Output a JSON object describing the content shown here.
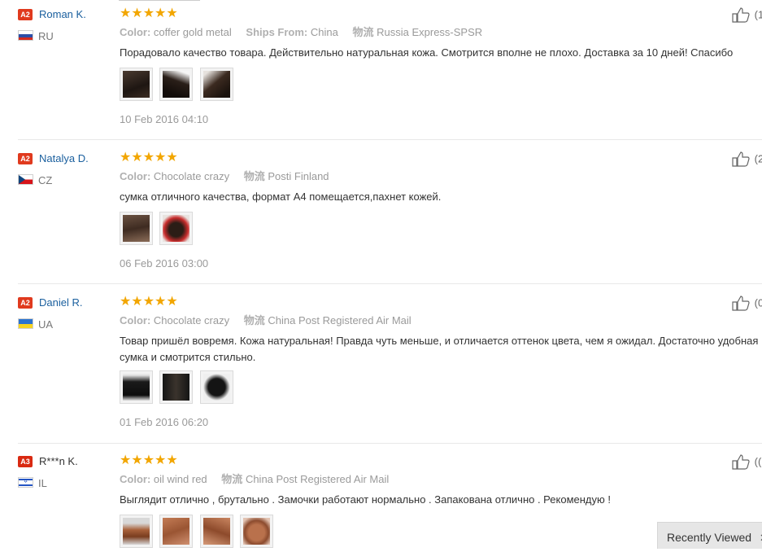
{
  "colors": {
    "star": "#f2a600",
    "link": "#1a5f9e",
    "badge_a2": "#e03a1e",
    "badge_a3": "#d92a12"
  },
  "reviews": [
    {
      "badge": "A2",
      "name": "Roman K.",
      "country": "RU",
      "flag": "ru",
      "stars": "★★★★★",
      "attr1_label": "Color:",
      "attr1_value": "coffer gold metal",
      "attr2_label": "Ships From:",
      "attr2_value": "China",
      "attr3_label": "物流",
      "attr3_value": "Russia Express-SPSR",
      "text": "Порадовало качество товара. Действительно натуральная кожа. Смотрится вполне не плохо. Доставка за 10 дней! Спасибо",
      "thumb_count": 3,
      "date": "10 Feb 2016 04:10",
      "likes": "(1"
    },
    {
      "badge": "A2",
      "name": "Natalya D.",
      "country": "CZ",
      "flag": "cz",
      "stars": "★★★★★",
      "attr1_label": "Color:",
      "attr1_value": "Chocolate crazy",
      "attr3_label": "物流",
      "attr3_value": "Posti Finland",
      "text": "сумка отличного качества, формат А4 помещается,пахнет кожей.",
      "thumb_count": 2,
      "date": "06 Feb 2016 03:00",
      "likes": "(2"
    },
    {
      "badge": "A2",
      "name": "Daniel R.",
      "country": "UA",
      "flag": "ua",
      "stars": "★★★★★",
      "attr1_label": "Color:",
      "attr1_value": "Chocolate crazy",
      "attr3_label": "物流",
      "attr3_value": "China Post Registered Air Mail",
      "text": "Товар пришёл вовремя. Кожа натуральная! Правда чуть меньше, и отличается оттенок цвета, чем я ожидал. Достаточно удобная сумка и смотрится стильно.",
      "thumb_count": 3,
      "date": "01 Feb 2016 06:20",
      "likes": "(0"
    },
    {
      "badge": "A3",
      "name": "R***n K.",
      "country": "IL",
      "flag": "il",
      "stars": "★★★★★",
      "attr1_label": "Color:",
      "attr1_value": "oil wind red",
      "attr3_label": "物流",
      "attr3_value": "China Post Registered Air Mail",
      "text": "Выглядит отлично , брутально . Замочки работают нормально . Запакована отлично . Рекомендую !",
      "thumb_count": 4,
      "date": "",
      "likes": "(("
    }
  ],
  "recently_viewed": {
    "label": "Recently Viewed",
    "icon": "close-icon"
  }
}
